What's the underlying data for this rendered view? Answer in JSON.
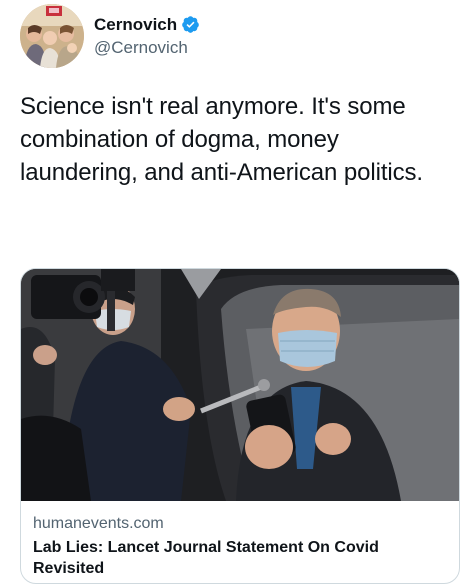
{
  "author": {
    "display_name": "Cernovich",
    "handle": "@Cernovich",
    "verified": true,
    "verified_color": "#1d9bf0",
    "avatar_icon": "profile-photo"
  },
  "tweet": {
    "text": "Science isn't real anymore. It's some combination of dogma, money laundering, and anti-American politics."
  },
  "link_card": {
    "image_icon": "news-photo-masked-man-in-car-surrounded-by-press",
    "domain": "humanevents.com",
    "title": "Lab Lies: Lancet Journal Statement On Covid Revisited"
  },
  "colors": {
    "text_primary": "#0f1419",
    "text_secondary": "#536471",
    "card_border": "#cfd9de"
  }
}
